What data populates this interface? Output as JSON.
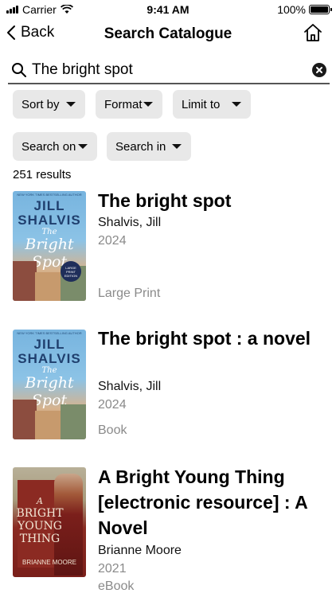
{
  "status_bar": {
    "carrier": "Carrier",
    "time": "9:41 AM",
    "battery": "100%",
    "battery_level": 1.0
  },
  "nav": {
    "back_label": "Back",
    "title": "Search Catalogue"
  },
  "search": {
    "value": "The bright spot"
  },
  "filters": {
    "sort_by": "Sort by",
    "format": "Format",
    "limit_to": "Limit to",
    "search_on": "Search on",
    "search_in": "Search in"
  },
  "results_count": "251 results",
  "results": [
    {
      "title": "The bright spot",
      "author": "Shalvis, Jill",
      "year": "2024",
      "format": "Large Print",
      "cover": {
        "top": "NEW YORK TIMES BESTSELLING AUTHOR",
        "author_first": "JILL",
        "author_last": "SHALVIS",
        "title_a": "The",
        "title_b": "Bright Spot",
        "badge": "LARGE PRINT EDITION"
      }
    },
    {
      "title": "The bright spot : a novel",
      "author": "Shalvis, Jill",
      "year": "2024",
      "format": "Book",
      "cover": {
        "top": "NEW YORK TIMES BESTSELLING AUTHOR",
        "author_first": "JILL",
        "author_last": "SHALVIS",
        "title_a": "The",
        "title_b": "Bright Spot"
      }
    },
    {
      "title": "A Bright Young Thing [electronic resource] : A Novel",
      "author": "Brianne Moore",
      "year": "2021",
      "format": "eBook",
      "cover": {
        "t1": "A",
        "t2": "BRIGHT",
        "t3": "YOUNG",
        "t4": "THING",
        "author": "BRIANNE MOORE"
      }
    }
  ],
  "colors": {
    "filter_bg": "#e8e8e8",
    "muted_text": "#8a8a8a"
  }
}
